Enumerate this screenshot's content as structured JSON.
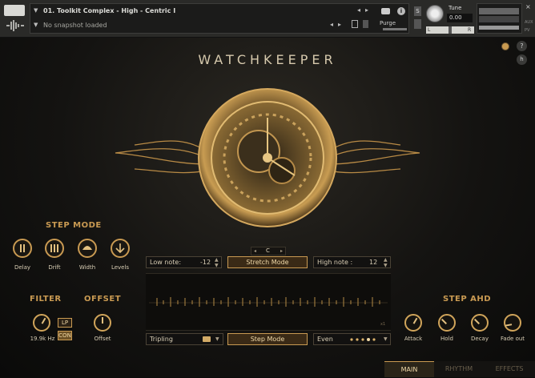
{
  "header": {
    "preset_name": "01. Toolkit Complex - High - Centric I",
    "snapshot": "No snapshot loaded",
    "purge_label": "Purge",
    "s_label": "S",
    "tune_label": "Tune",
    "tune_value": "0.00",
    "lr_left": "L",
    "lr_right": "R",
    "aux_label": "AUX",
    "pv_label": "PV",
    "info_label": "i",
    "close_label": "×"
  },
  "main": {
    "title": "WATCHKEEPER",
    "help_label": "?",
    "h_label": "h"
  },
  "step_mode": {
    "title": "STEP MODE",
    "buttons": [
      {
        "label": "Delay",
        "icon": "pause-icon"
      },
      {
        "label": "Drift",
        "icon": "bars-icon"
      },
      {
        "label": "Width",
        "icon": "width-icon"
      },
      {
        "label": "Levels",
        "icon": "levels-icon"
      }
    ]
  },
  "filter": {
    "title": "FILTER",
    "value": "19.9k Hz",
    "lp_label": "LP",
    "con_label": "CON"
  },
  "offset": {
    "title": "OFFSET",
    "label": "Offset"
  },
  "center": {
    "key_label": "C",
    "low_note_label": "Low note:",
    "low_note_value": "-12",
    "stretch_mode_label": "Stretch Mode",
    "high_note_label": "High note :",
    "high_note_value": "12",
    "tripling_label": "Tripling",
    "step_mode_label": "Step Mode",
    "even_label": "Even",
    "display_marker": "x1"
  },
  "step_ahd": {
    "title": "STEP AHD",
    "knobs": [
      "Attack",
      "Hold",
      "Decay",
      "Fade out"
    ]
  },
  "tabs": [
    {
      "label": "MAIN",
      "active": true
    },
    {
      "label": "RHYTHM",
      "active": false
    },
    {
      "label": "EFFECTS",
      "active": false
    }
  ],
  "colors": {
    "accent": "#c99a52",
    "accent_bright": "#f0d9a8",
    "background": "#0b0b0a"
  }
}
